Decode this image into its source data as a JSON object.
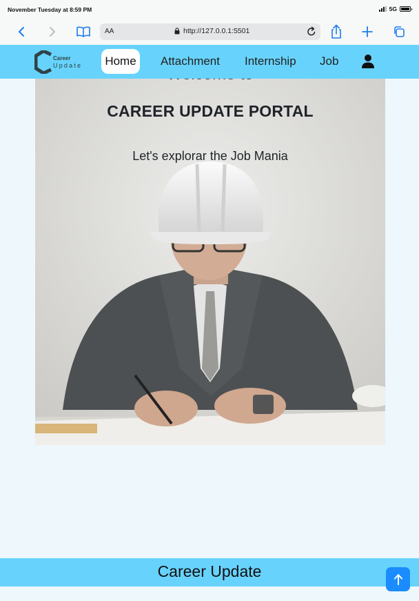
{
  "status_bar": {
    "time": "November Tuesday at 8:59 PM",
    "network": "5G",
    "battery_level": 1.0
  },
  "browser": {
    "text_size_label": "AA",
    "url": "http://127.0.0.1:5501"
  },
  "navbar": {
    "logo": {
      "line1": "Career",
      "line2": "Update"
    },
    "items": [
      {
        "label": "Home",
        "active": true
      },
      {
        "label": "Attachment"
      },
      {
        "label": "Internship"
      },
      {
        "label": "Job"
      }
    ]
  },
  "hero": {
    "welcome": "Welcome to",
    "title": "CAREER UPDATE PORTAL",
    "subtitle": "Let's explorar the Job Mania"
  },
  "footer": {
    "title": "Career Update"
  },
  "colors": {
    "navbar_bg": "#67d3fc",
    "page_bg": "#eef7fc",
    "active_tab_bg": "#ffffff",
    "scroll_top_button": "#1a8cff"
  },
  "icons": {
    "back": "chevron-left-icon",
    "forward": "chevron-right-icon",
    "bookmarks": "book-icon",
    "lock": "lock-icon",
    "reload": "reload-icon",
    "share": "share-icon",
    "new_tab": "plus-icon",
    "tabs": "tabs-icon",
    "user": "user-icon",
    "scroll_top": "arrow-up-icon"
  }
}
